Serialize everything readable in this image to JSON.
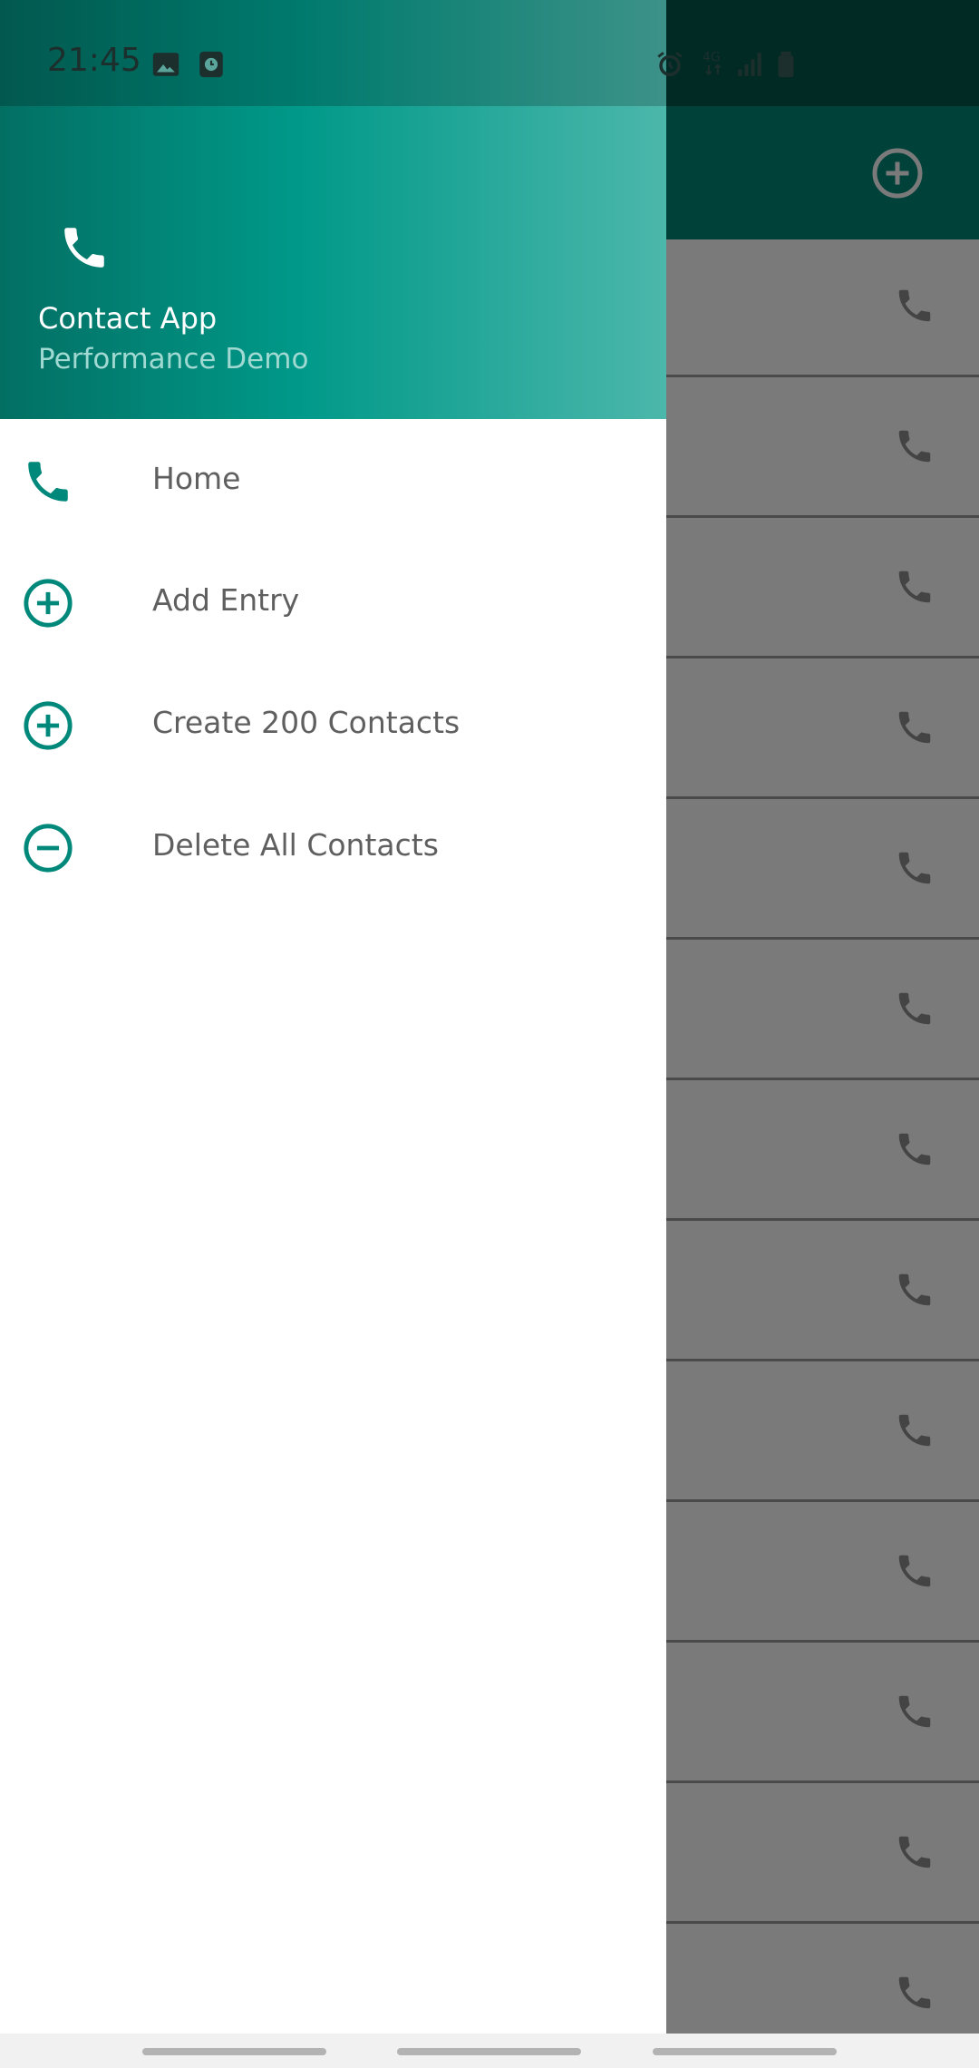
{
  "status_bar": {
    "time": "21:45",
    "left_icons": [
      "image-icon",
      "clock-icon"
    ],
    "right_icons": [
      "alarm-icon",
      "4g-network-icon",
      "signal-icon",
      "battery-icon"
    ]
  },
  "app_bar": {
    "color": "#008a7a",
    "action_icon": "add-circle-icon"
  },
  "background_list": {
    "row_icon": "phone-icon",
    "visible_rows": 13
  },
  "drawer": {
    "header": {
      "icon": "phone-icon",
      "title": "Contact App",
      "subtitle": "Performance Demo"
    },
    "accent_color": "#00897b",
    "items": [
      {
        "label": "Home",
        "icon": "phone-icon"
      },
      {
        "label": "Add Entry",
        "icon": "add-circle-icon"
      },
      {
        "label": "Create 200 Contacts",
        "icon": "add-circle-icon"
      },
      {
        "label": "Delete All Contacts",
        "icon": "remove-circle-icon"
      }
    ]
  }
}
